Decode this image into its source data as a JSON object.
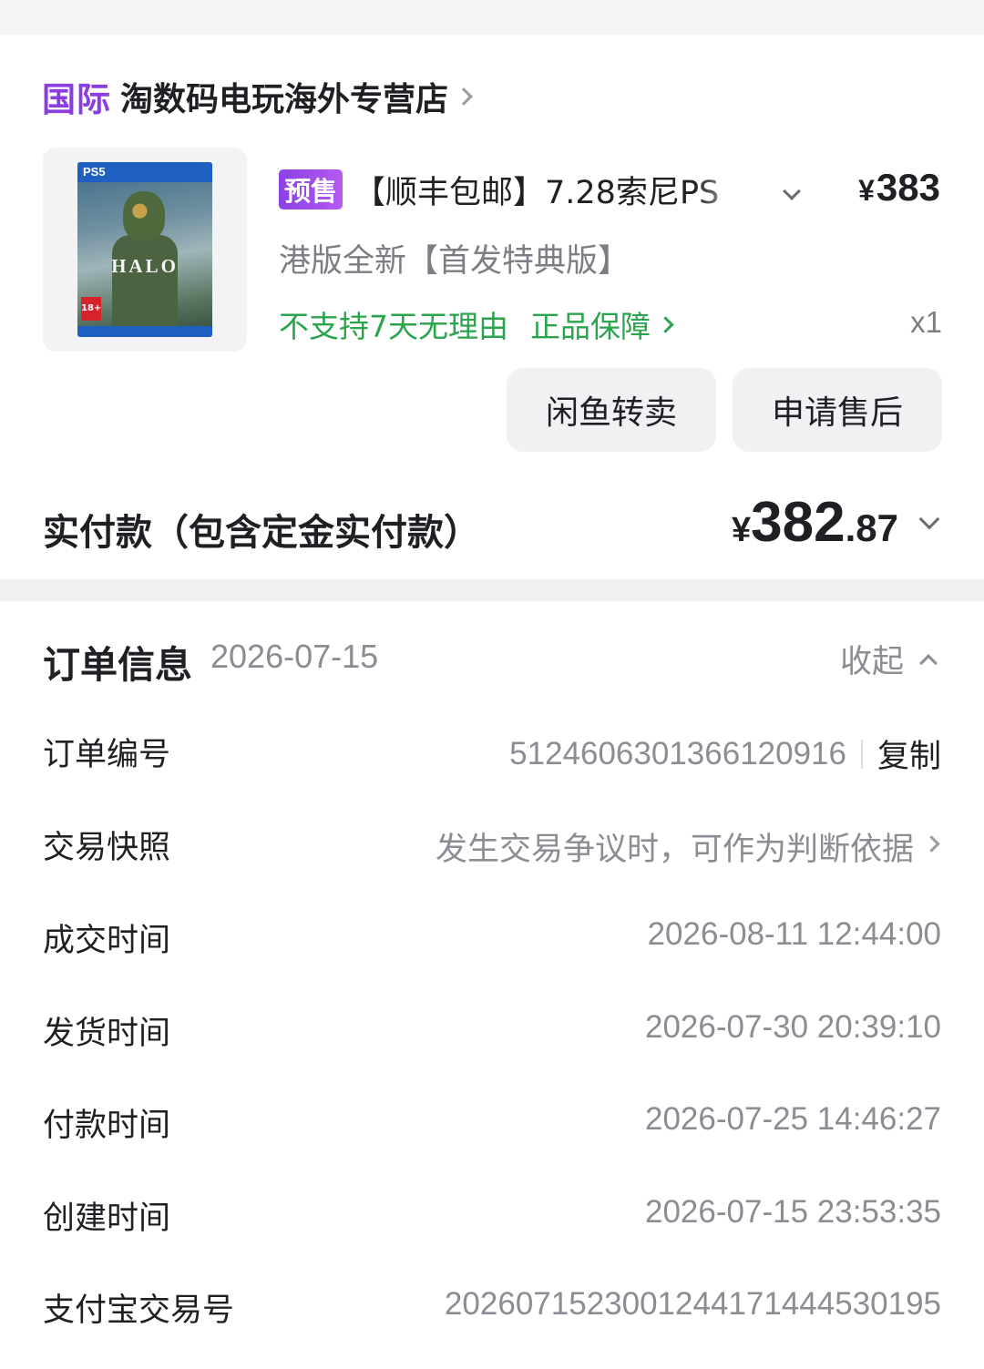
{
  "store": {
    "badge": "国际",
    "name": "淘数码电玩海外专营店"
  },
  "product": {
    "cover_platform": "PS5",
    "cover_title": "HALO",
    "cover_rating": "18+",
    "presale_badge": "预售",
    "title": "【顺丰包邮】7.28索尼PS",
    "price_symbol": "¥",
    "price": "383",
    "spec": "港版全新【首发特典版】",
    "no_return": "不支持7天无理由",
    "authentic": "正品保障",
    "quantity": "x1"
  },
  "actions": {
    "resell": "闲鱼转卖",
    "after_sale": "申请售后"
  },
  "payment": {
    "label": "实付款（包含定金实付款）",
    "symbol": "¥",
    "integer": "382",
    "decimal": ".87"
  },
  "order_info": {
    "title": "订单信息",
    "date": "2026-07-15",
    "collapse": "收起",
    "rows": [
      {
        "label": "订单编号",
        "value": "5124606301366120916",
        "action": "复制"
      },
      {
        "label": "交易快照",
        "value": "发生交易争议时，可作为判断依据"
      },
      {
        "label": "成交时间",
        "value": "2026-08-11 12:44:00"
      },
      {
        "label": "发货时间",
        "value": "2026-07-30 20:39:10"
      },
      {
        "label": "付款时间",
        "value": "2026-07-25 14:46:27"
      },
      {
        "label": "创建时间",
        "value": "2026-07-15 23:53:35"
      },
      {
        "label": "支付宝交易号",
        "value": "2026071523001244171444530195"
      }
    ]
  },
  "colors": {
    "accent_purple": "#8a3ee0",
    "green": "#2aa54e",
    "muted": "#8c8c94"
  }
}
